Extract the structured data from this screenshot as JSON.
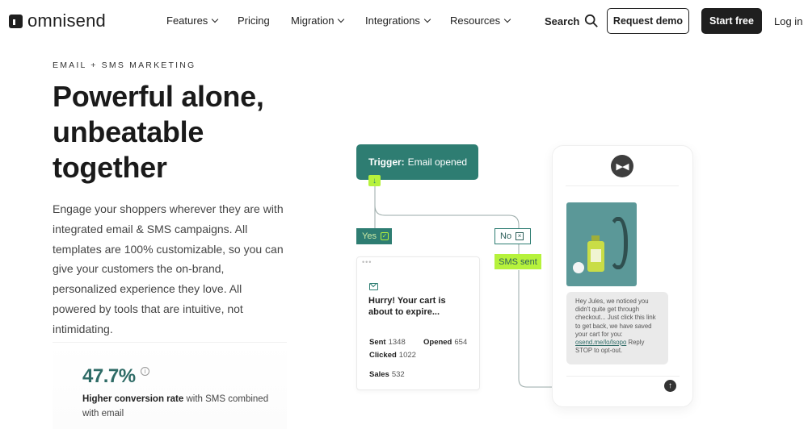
{
  "brand": {
    "name": "omnisend"
  },
  "nav": {
    "items": [
      {
        "label": "Features",
        "has_dropdown": true
      },
      {
        "label": "Pricing",
        "has_dropdown": false
      },
      {
        "label": "Migration",
        "has_dropdown": true
      },
      {
        "label": "Integrations",
        "has_dropdown": true
      },
      {
        "label": "Resources",
        "has_dropdown": true
      }
    ],
    "search_label": "Search",
    "request_demo": "Request demo",
    "start_free": "Start free",
    "login": "Log in"
  },
  "hero": {
    "eyebrow": "EMAIL + SMS MARKETING",
    "headline_line1": "Powerful alone,",
    "headline_line2": "unbeatable",
    "headline_line3": "together",
    "body": "Engage your shoppers wherever they are with integrated email & SMS campaigns. All templates are 100% customizable, so you can give your customers the on-brand, personalized experience they love. All powered by tools that are intuitive, not intimidating."
  },
  "stat": {
    "value": "47.7%",
    "caption_bold": "Higher conversion rate",
    "caption_rest": " with SMS combined with email"
  },
  "flow": {
    "trigger_label": "Trigger:",
    "trigger_value": "Email opened",
    "yes": "Yes",
    "no": "No",
    "sms_sent": "SMS sent",
    "email_subject": "Hurry! Your cart is about to expire...",
    "metrics": {
      "sent_label": "Sent",
      "sent_value": "1348",
      "opened_label": "Opened",
      "opened_value": "654",
      "clicked_label": "Clicked",
      "clicked_value": "1022",
      "sales_label": "Sales",
      "sales_value": "532"
    }
  },
  "phone": {
    "sms_text_before": "Hey Jules, we noticed you didn't quite get through checkout... Just click this link to get back, we have saved your cart for you: ",
    "sms_link": "osend.me/lo/lsopo",
    "sms_text_after": " Reply STOP to opt-out."
  },
  "colors": {
    "accent_teal": "#2e7d72",
    "accent_lime": "#b6f23c",
    "dark": "#1f1f1f"
  }
}
